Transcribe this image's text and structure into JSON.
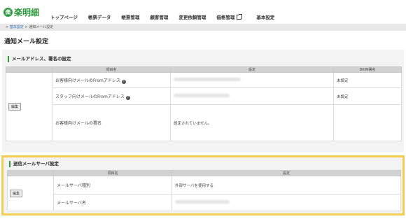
{
  "app": {
    "logo_mark": "楽",
    "logo_text": "楽明細"
  },
  "nav": {
    "items": [
      "トップページ",
      "帳票データ",
      "帳票管理",
      "顧客管理",
      "変更依頼管理",
      "価格管理",
      "基本設定"
    ]
  },
  "breadcrumb": {
    "sep1": ">",
    "root": "基本設定",
    "sep2": ">",
    "current": "通知メール設定"
  },
  "page_title": "通知メール設定",
  "section1": {
    "title": "メールアドレス、署名の設定",
    "headers": [
      "",
      "項目名",
      "設定",
      "DKIM署名"
    ],
    "edit_label": "編集",
    "rows": [
      {
        "label": "お客様向けメールのFromアドレス",
        "value": "",
        "dkim": "未設定"
      },
      {
        "label": "スタッフ向けメールのFromアドレス",
        "value": "",
        "dkim": "未設定"
      },
      {
        "label": "お客様向けメールの署名",
        "value": "設定されていません。",
        "dkim": ""
      }
    ]
  },
  "section2": {
    "title": "送信メールサーバ設定",
    "headers": [
      "",
      "項目名",
      "設定"
    ],
    "edit_label": "編集",
    "rows": [
      {
        "label": "メールサーバ種別",
        "value": "外部サーバを使用する"
      },
      {
        "label": "メールサーバ名",
        "value": ""
      }
    ]
  },
  "colors": {
    "brand": "#2e9a3e",
    "highlight": "#f2cf53"
  }
}
